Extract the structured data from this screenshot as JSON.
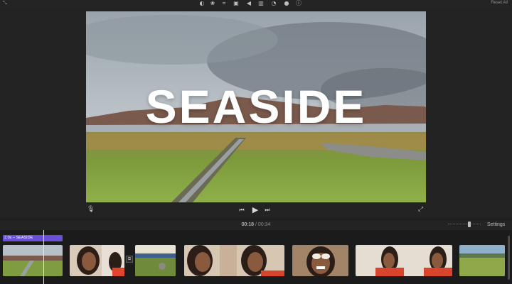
{
  "toolbar": {
    "icons": [
      "color-balance-icon",
      "color-correction-icon",
      "crop-icon",
      "stabilization-icon",
      "volume-icon",
      "noise-reduction-icon",
      "speed-icon",
      "clip-filter-icon",
      "info-icon"
    ],
    "reset_all_label": "Reset All"
  },
  "viewer": {
    "title_text": "SEASIDE"
  },
  "playback": {
    "current_time": "00:18",
    "separator": "/",
    "total_time": "00:34"
  },
  "timeline": {
    "settings_label": "Settings",
    "title_clip_label": "2.0s – SEASIDE"
  },
  "colors": {
    "title_clip": "#6a4fd8",
    "background": "#232323",
    "timeline_bg": "#1b1b1b"
  }
}
